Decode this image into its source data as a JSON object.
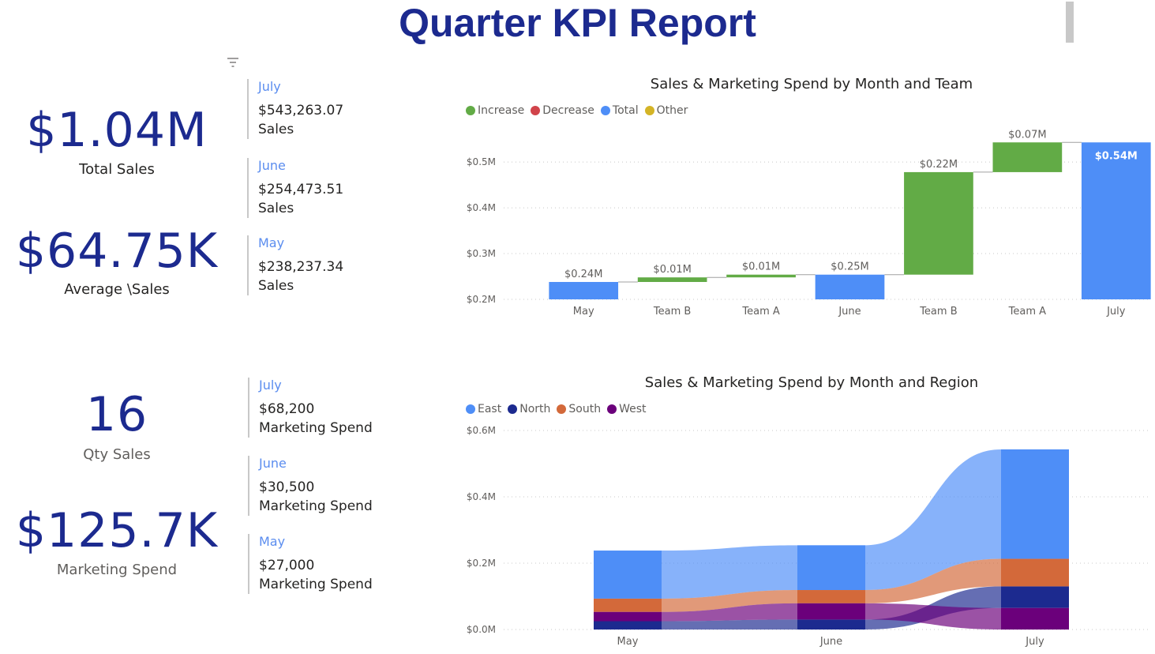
{
  "report": {
    "title": "Quarter KPI Report"
  },
  "kpis": [
    {
      "value": "$1.04M",
      "label": "Total Sales"
    },
    {
      "value": "$64.75K",
      "label": "Average \\Sales"
    },
    {
      "value": "16",
      "label": "Qty Sales"
    },
    {
      "value": "$125.7K",
      "label": "Marketing Spend"
    }
  ],
  "sales_cards": [
    {
      "month": "July",
      "value": "$543,263.07",
      "label": "Sales"
    },
    {
      "month": "June",
      "value": "$254,473.51",
      "label": "Sales"
    },
    {
      "month": "May",
      "value": "$238,237.34",
      "label": "Sales"
    }
  ],
  "marketing_cards": [
    {
      "month": "July",
      "value": "$68,200",
      "label": "Marketing Spend"
    },
    {
      "month": "June",
      "value": "$30,500",
      "label": "Marketing Spend"
    },
    {
      "month": "May",
      "value": "$27,000",
      "label": "Marketing Spend"
    }
  ],
  "icons": {
    "filter": "filter-icon"
  },
  "chart_data": [
    {
      "type": "waterfall",
      "title": "Sales & Marketing Spend by Month and Team",
      "legend": [
        {
          "name": "Increase",
          "color": "#62ab46"
        },
        {
          "name": "Decrease",
          "color": "#d1434a"
        },
        {
          "name": "Total",
          "color": "#4e8ef7"
        },
        {
          "name": "Other",
          "color": "#d4b426"
        }
      ],
      "legend_position": "top-left",
      "categories": [
        "May",
        "Team B",
        "Team A",
        "June",
        "Team B",
        "Team A",
        "July"
      ],
      "bars": [
        {
          "kind": "Total",
          "start": 0,
          "end": 0.238,
          "label": "$0.24M"
        },
        {
          "kind": "Increase",
          "start": 0.238,
          "end": 0.248,
          "label": "$0.01M"
        },
        {
          "kind": "Increase",
          "start": 0.248,
          "end": 0.254,
          "label": "$0.01M"
        },
        {
          "kind": "Total",
          "start": 0,
          "end": 0.254,
          "label": "$0.25M"
        },
        {
          "kind": "Increase",
          "start": 0.254,
          "end": 0.478,
          "label": "$0.22M"
        },
        {
          "kind": "Increase",
          "start": 0.478,
          "end": 0.543,
          "label": "$0.07M"
        },
        {
          "kind": "Total",
          "start": 0,
          "end": 0.543,
          "label": "$0.54M"
        }
      ],
      "yticks": [
        {
          "v": 0.2,
          "label": "$0.2M"
        },
        {
          "v": 0.3,
          "label": "$0.3M"
        },
        {
          "v": 0.4,
          "label": "$0.4M"
        },
        {
          "v": 0.5,
          "label": "$0.5M"
        }
      ],
      "ylim": [
        0.2,
        0.54
      ],
      "grid": true
    },
    {
      "type": "ribbon",
      "title": "Sales & Marketing Spend by Month and Region",
      "categories": [
        "May",
        "June",
        "July"
      ],
      "series": [
        {
          "name": "East",
          "color": "#4e8ef7",
          "values": [
            0.145,
            0.135,
            0.33
          ]
        },
        {
          "name": "North",
          "color": "#1c2a8f",
          "values": [
            0.025,
            0.03,
            0.065
          ]
        },
        {
          "name": "South",
          "color": "#d3693a",
          "values": [
            0.04,
            0.04,
            0.083
          ]
        },
        {
          "name": "West",
          "color": "#6b007b",
          "values": [
            0.028,
            0.049,
            0.065
          ]
        }
      ],
      "ranking": [
        [
          "East",
          "South",
          "West",
          "North"
        ],
        [
          "East",
          "South",
          "West",
          "North"
        ],
        [
          "East",
          "South",
          "North",
          "West"
        ]
      ],
      "legend_position": "top-left",
      "yticks": [
        {
          "v": 0,
          "label": "$0.0M"
        },
        {
          "v": 0.2,
          "label": "$0.2M"
        },
        {
          "v": 0.4,
          "label": "$0.4M"
        },
        {
          "v": 0.6,
          "label": "$0.6M"
        }
      ],
      "ylim": [
        0,
        0.6
      ],
      "grid": true
    }
  ]
}
